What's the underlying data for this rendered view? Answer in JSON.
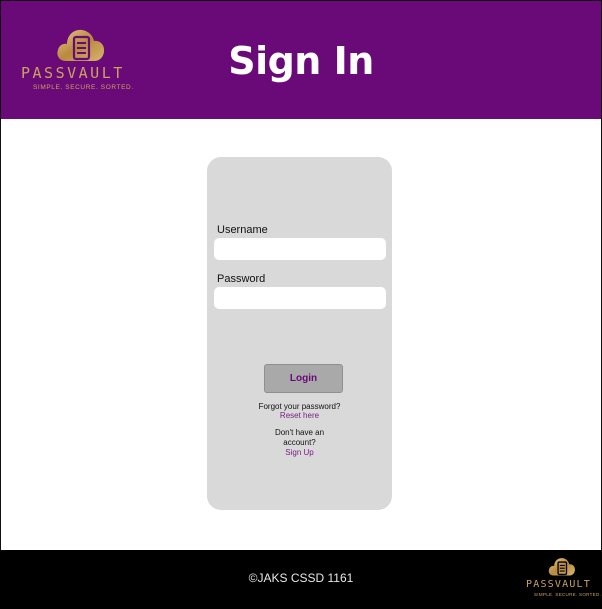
{
  "header": {
    "title": "Sign In",
    "logo": {
      "icon": "cloud-server-icon",
      "wordmark": "PASSVAULT",
      "tagline": "SIMPLE. SECURE. SORTED."
    }
  },
  "form": {
    "username_label": "Username",
    "username_value": "",
    "password_label": "Password",
    "password_value": "",
    "login_label": "Login",
    "forgot_text": "Forgot your password?",
    "reset_link": "Reset here",
    "no_account_line1": "Don't have an",
    "no_account_line2": "account?",
    "signup_link": "Sign Up"
  },
  "footer": {
    "copyright": "©JAKS CSSD 1161",
    "logo": {
      "icon": "cloud-server-icon",
      "wordmark": "PASSVAULT",
      "tagline": "SIMPLE. SECURE. SORTED."
    }
  },
  "colors": {
    "brand_purple": "#6a0a78",
    "gold": "#c9a45c",
    "card_bg": "#d9d9d9",
    "button_bg": "#a9a9a9",
    "footer_bg": "#000000"
  }
}
